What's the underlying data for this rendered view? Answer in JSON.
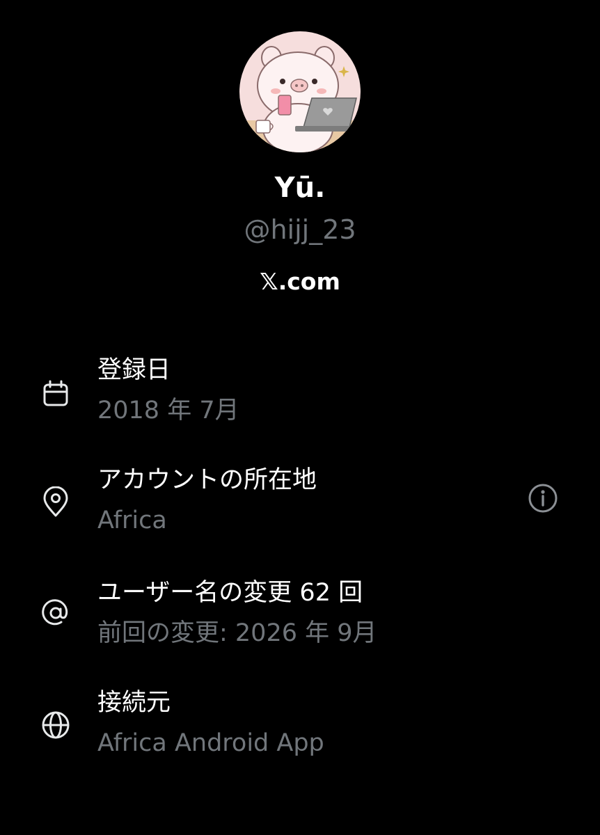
{
  "profile": {
    "display_name": "Yū.",
    "handle": "@hijj_23",
    "site": "𝕏.com",
    "avatar_icon": "pig-avatar"
  },
  "about": {
    "joined": {
      "title": "登録日",
      "value": "2018 年 7月",
      "icon": "calendar-icon"
    },
    "location": {
      "title": "アカウントの所在地",
      "value": "Africa",
      "icon": "location-pin-icon",
      "info_icon": "info-icon"
    },
    "username_changes": {
      "title": "ユーザー名の変更 62 回",
      "value": "前回の変更: 2026 年 9月",
      "icon": "at-sign-icon"
    },
    "connected_via": {
      "title": "接続元",
      "value": "Africa Android App",
      "icon": "globe-icon"
    }
  },
  "colors": {
    "background": "#000000",
    "primary_text": "#ffffff",
    "secondary_text": "#71767b"
  }
}
